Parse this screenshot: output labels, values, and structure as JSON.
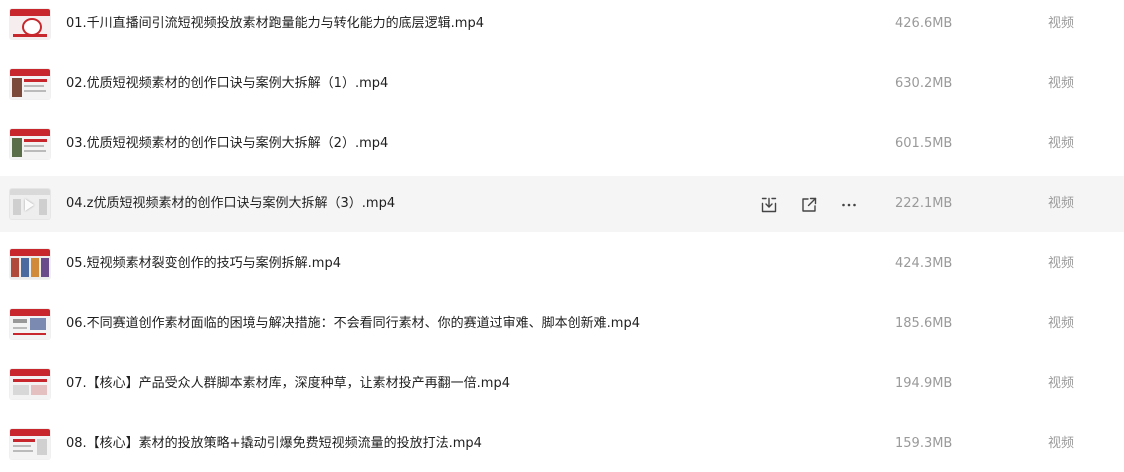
{
  "files": [
    {
      "name": "01.千川直播间引流短视频投放素材跑量能力与转化能力的底层逻辑.mp4",
      "size": "426.6MB",
      "type": "视频"
    },
    {
      "name": "02.优质短视频素材的创作口诀与案例大拆解（1）.mp4",
      "size": "630.2MB",
      "type": "视频"
    },
    {
      "name": "03.优质短视频素材的创作口诀与案例大拆解（2）.mp4",
      "size": "601.5MB",
      "type": "视频"
    },
    {
      "name": "04.z优质短视频素材的创作口诀与案例大拆解（3）.mp4",
      "size": "222.1MB",
      "type": "视频"
    },
    {
      "name": "05.短视频素材裂变创作的技巧与案例拆解.mp4",
      "size": "424.3MB",
      "type": "视频"
    },
    {
      "name": "06.不同赛道创作素材面临的困境与解决措施：不会看同行素材、你的赛道过审难、脚本创新难.mp4",
      "size": "185.6MB",
      "type": "视频"
    },
    {
      "name": "07.【核心】产品受众人群脚本素材库，深度种草，让素材投产再翻一倍.mp4",
      "size": "194.9MB",
      "type": "视频"
    },
    {
      "name": "08.【核心】素材的投放策略+撬动引爆免费短视频流量的投放打法.mp4",
      "size": "159.3MB",
      "type": "视频"
    }
  ],
  "hover_row_index": 3,
  "icons": {
    "download": "download-icon",
    "share": "share-icon",
    "more": "more-icon"
  },
  "colors": {
    "hover_bg": "#f5f5f6",
    "text": "#1f1f1f",
    "muted": "#9a9a9a",
    "thumb_red": "#c8282d"
  }
}
